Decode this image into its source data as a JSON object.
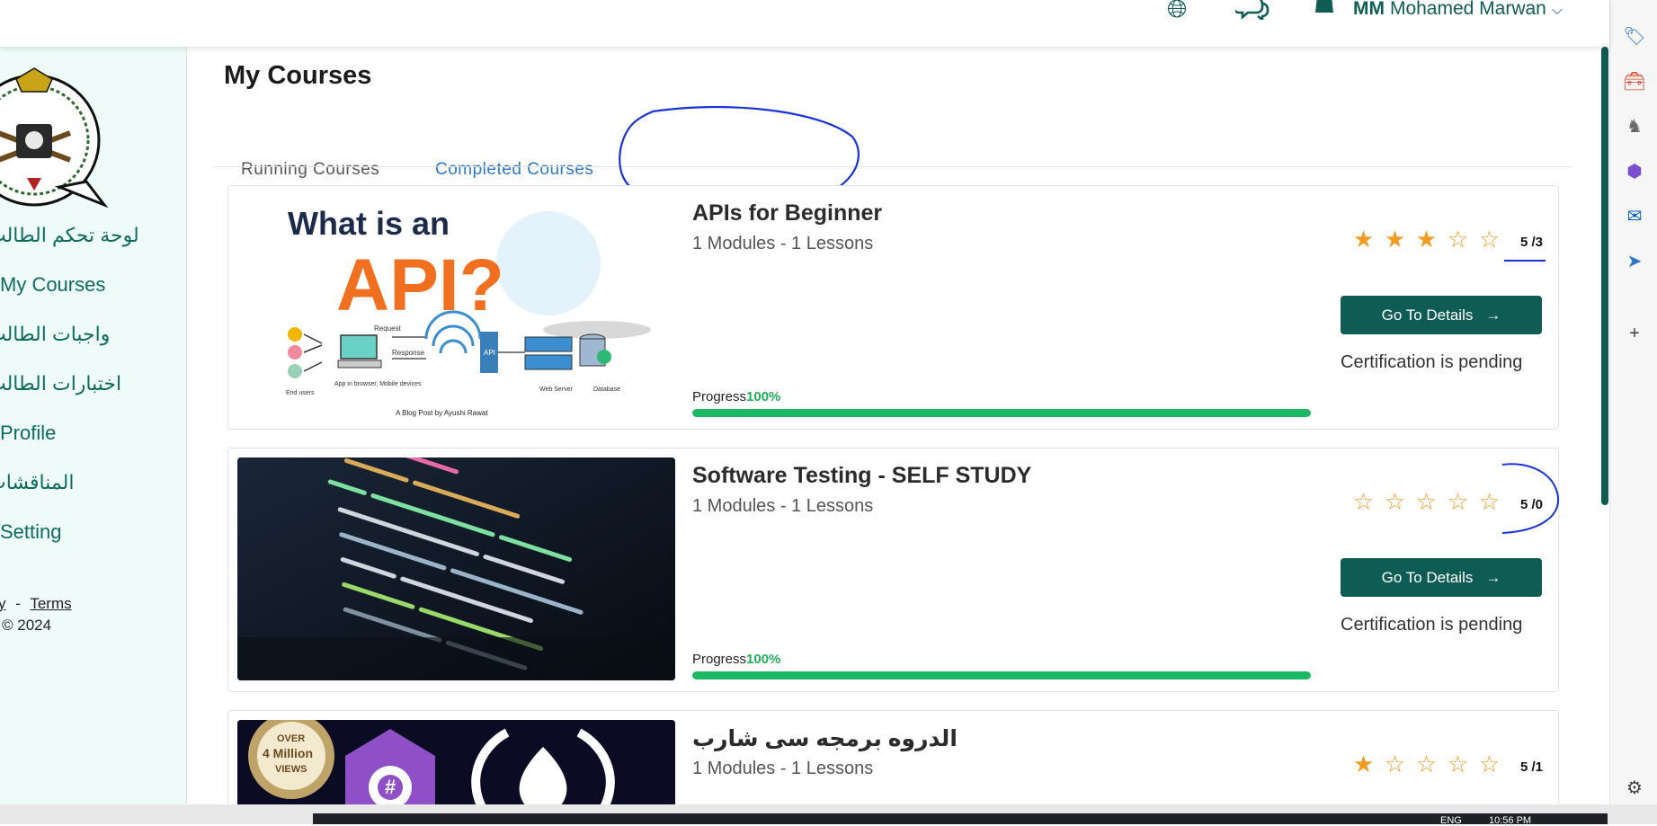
{
  "header": {
    "user_initials": "MM",
    "user_name": "Mohamed Marwan"
  },
  "sidebar": {
    "items": [
      {
        "label": "لوحة تحكم الطالب",
        "rtl": true
      },
      {
        "label": "My Courses",
        "rtl": false
      },
      {
        "label": "واجبات الطالب",
        "rtl": true
      },
      {
        "label": "اختبارات الطالب",
        "rtl": true
      },
      {
        "label": "Profile",
        "rtl": false
      },
      {
        "label": "المناقشات",
        "rtl": true
      },
      {
        "label": "Setting",
        "rtl": false
      }
    ],
    "footer": {
      "policy_fragment": "y",
      "separator": "-",
      "terms": "Terms",
      "copyright": "© 2024"
    }
  },
  "main": {
    "title": "My Courses",
    "tabs": [
      {
        "label": "Running Courses",
        "active": false
      },
      {
        "label": "Completed Courses",
        "active": true
      }
    ]
  },
  "courses": [
    {
      "title": "APIs for Beginner",
      "meta": "1 Modules - 1 Lessons",
      "rating": 3,
      "score_text": "5 /3",
      "progress_label": "Progress",
      "progress_value": "100%",
      "progress_fraction": 1.0,
      "button_label": "Go To Details",
      "status": "Certification is pending",
      "thumb": {
        "heading": "What is an",
        "big": "API?",
        "request": "Request",
        "response": "Response",
        "end_users": "End users",
        "app": "App in browser, Mobile devices",
        "api": "API",
        "web_server": "Web Server",
        "database": "Database",
        "credit": "A Blog Post by Ayushi Rawat"
      }
    },
    {
      "title": "Software Testing - SELF STUDY",
      "meta": "1 Modules - 1 Lessons",
      "rating": 0,
      "score_text": "5 /0",
      "progress_label": "Progress",
      "progress_value": "100%",
      "progress_fraction": 1.0,
      "button_label": "Go To Details",
      "status": "Certification is pending"
    },
    {
      "title": "الدروه برمجه سى شارب",
      "meta": "1 Modules - 1 Lessons",
      "rating": 1,
      "score_text": "5 /1",
      "thumb": {
        "badge_over": "OVER",
        "badge_count": "4 Million",
        "badge_views": "VIEWS",
        "lang": "#"
      }
    }
  ],
  "tray": {
    "lang": "ENG",
    "time": "10:56 PM"
  },
  "colors": {
    "brand": "#0e5c54",
    "accent_blue": "#2a78c6",
    "star": "#f39a21",
    "progress": "#1db863",
    "annotation": "#1a33d6"
  }
}
